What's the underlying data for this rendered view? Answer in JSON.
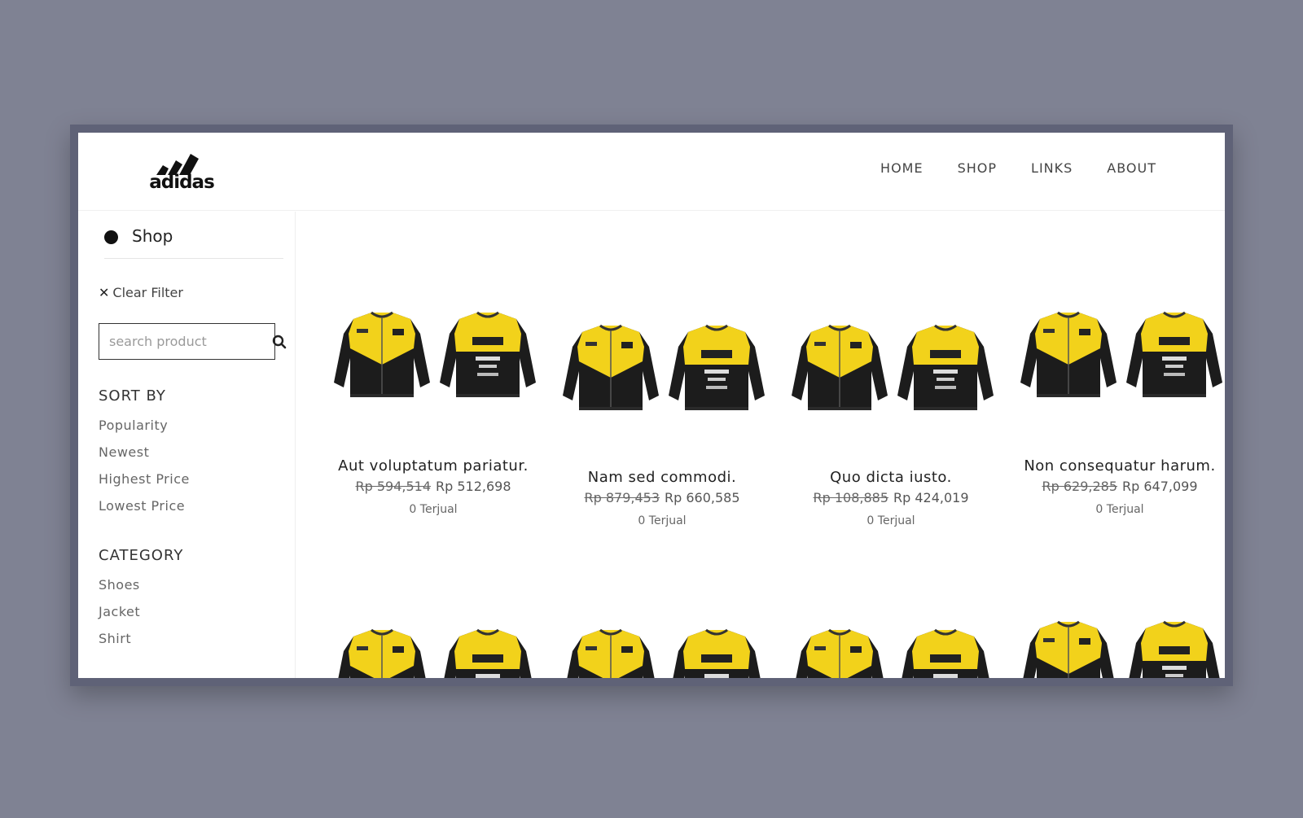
{
  "brand": {
    "name": "adidas"
  },
  "nav": {
    "items": [
      "HOME",
      "SHOP",
      "LINKS",
      "ABOUT"
    ]
  },
  "sidebar": {
    "title": "Shop",
    "clear_filter": "Clear Filter",
    "search_placeholder": "search product",
    "sort_title": "SORT BY",
    "sort_options": [
      "Popularity",
      "Newest",
      "Highest Price",
      "Lowest Price"
    ],
    "category_title": "CATEGORY",
    "categories": [
      "Shoes",
      "Jacket",
      "Shirt"
    ]
  },
  "products": [
    {
      "name": "Aut voluptatum pariatur.",
      "old_price": "Rp 594,514",
      "price": "Rp 512,698",
      "sold": "0 Terjual"
    },
    {
      "name": "Nam sed commodi.",
      "old_price": "Rp 879,453",
      "price": "Rp 660,585",
      "sold": "0 Terjual"
    },
    {
      "name": "Quo dicta iusto.",
      "old_price": "Rp 108,885",
      "price": "Rp 424,019",
      "sold": "0 Terjual"
    },
    {
      "name": "Non consequatur harum.",
      "old_price": "Rp 629,285",
      "price": "Rp 647,099",
      "sold": "0 Terjual"
    }
  ],
  "colors": {
    "jacket_yellow": "#f2d21b",
    "jacket_black": "#1c1c1c",
    "backdrop": "#7f8293"
  },
  "icons": {
    "search": "search-icon",
    "clear": "close-icon",
    "bullet": "dot-icon"
  }
}
